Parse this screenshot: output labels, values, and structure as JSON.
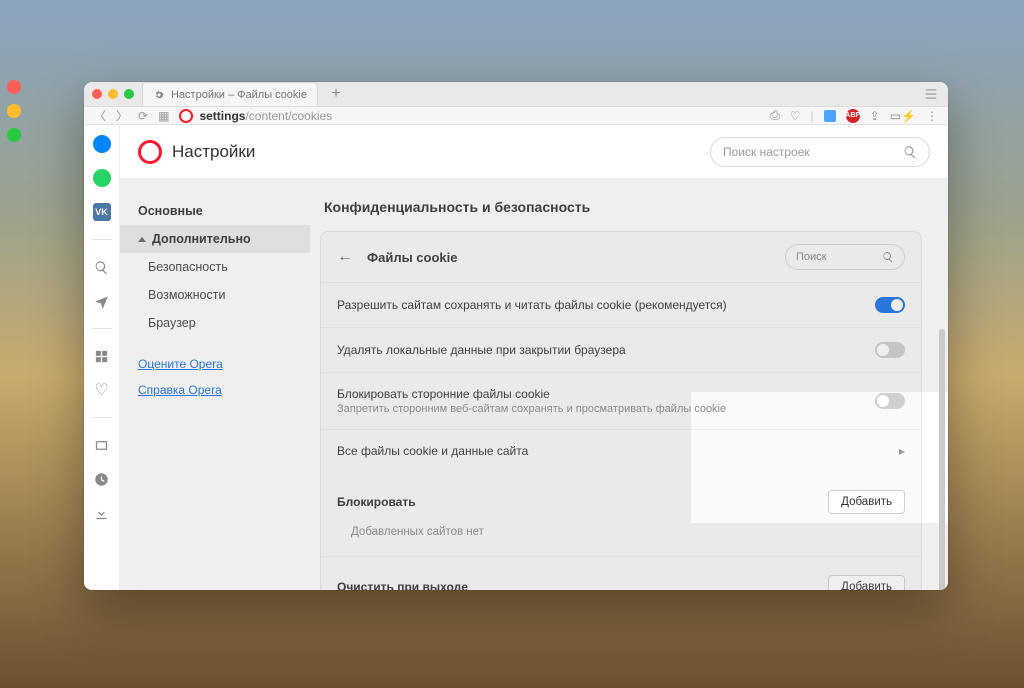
{
  "tab": {
    "title": "Настройки – Файлы cookie"
  },
  "url": {
    "bold": "settings",
    "rest": "/content/cookies"
  },
  "header": {
    "title": "Настройки",
    "search_placeholder": "Поиск настроек"
  },
  "sidenav": {
    "basic": "Основные",
    "advanced": "Дополнительно",
    "security": "Безопасность",
    "features": "Возможности",
    "browser": "Браузер",
    "rate": "Оцените Opera",
    "help": "Справка Opera"
  },
  "section": {
    "title": "Конфиденциальность и безопасность"
  },
  "card": {
    "back": "←",
    "title": "Файлы cookie",
    "search": "Поиск"
  },
  "rows": {
    "allow": "Разрешить сайтам сохранять и читать файлы cookie (рекомендуется)",
    "delete_on_close": "Удалять локальные данные при закрытии браузера",
    "block3p_title": "Блокировать сторонние файлы cookie",
    "block3p_sub": "Запретить сторонним веб-сайтам сохранять и просматривать файлы cookie",
    "all_cookies": "Все файлы cookie и данные сайта"
  },
  "block": {
    "title": "Блокировать",
    "add": "Добавить",
    "empty": "Добавленных сайтов нет"
  },
  "clear": {
    "title": "Очистить при выходе",
    "add": "Добавить"
  },
  "abp": "ABP",
  "vk": "VK"
}
